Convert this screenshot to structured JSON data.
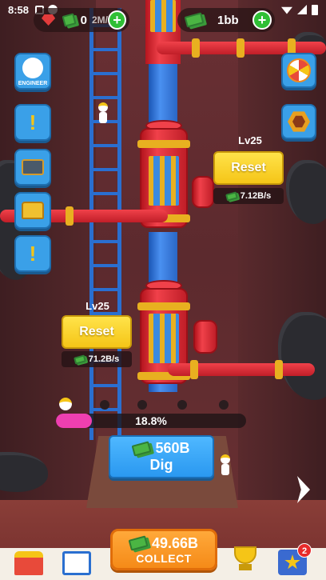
{
  "status_bar": {
    "time": "8:58"
  },
  "currency": {
    "gems": "0",
    "cash_rate_partial": "2M/",
    "cash": "1bb"
  },
  "side_buttons": {
    "engineer_label": "ENGINEER"
  },
  "stations": [
    {
      "level": "Lv25",
      "action": "Reset",
      "rate": "7.12B/s"
    },
    {
      "level": "Lv25",
      "action": "Reset",
      "rate": "71.2B/s"
    }
  ],
  "progress": {
    "percent_text": "18.8%",
    "value": 0.188
  },
  "dig": {
    "amount": "560B",
    "label": "Dig"
  },
  "collect": {
    "amount": "49.66B",
    "label": "COLLECT"
  },
  "bottom_nav": {
    "notification_count": "2"
  },
  "colors": {
    "accent_blue": "#3aa0e8",
    "reset_yellow": "#f5c517",
    "collect_orange": "#f58a18",
    "progress_pink": "#ee3fb0",
    "plus_green": "#2fbf35"
  }
}
